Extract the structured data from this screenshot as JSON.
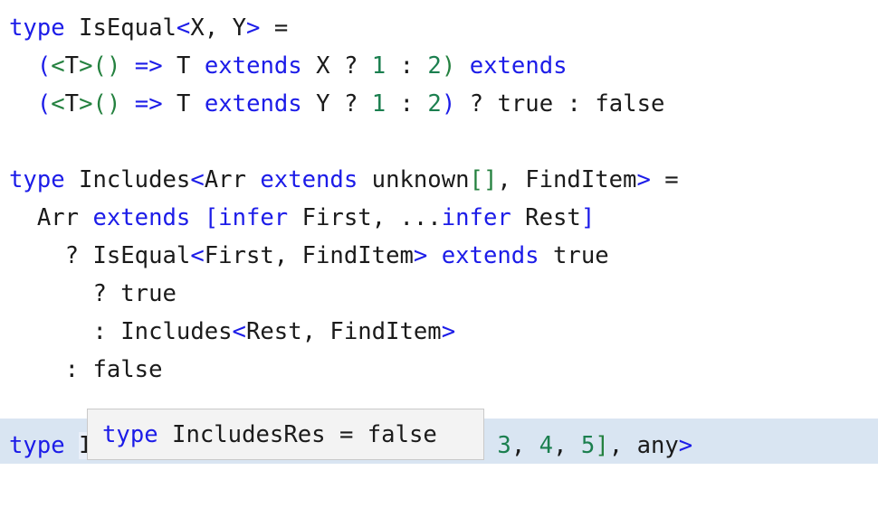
{
  "editor": {
    "language": "TypeScript",
    "background_color": "#ffffff",
    "font_size_px": 25.6,
    "line_height_px": 42,
    "colors": {
      "keyword_blue": "#1c1ce8",
      "literal_green": "#1b7f4f",
      "bracket_green": "#24813f",
      "plain_text": "#1b1b1b",
      "active_line_band": "#d9e5f2",
      "word_occurrence_highlight": "#e9eff9",
      "tooltip_background": "#f3f3f3",
      "tooltip_border": "#c9c9c9"
    }
  },
  "code": {
    "lines": [
      {
        "id": "line-1",
        "plain": "type IsEqual<X, Y> =",
        "tokens": [
          {
            "t": "type",
            "c": "kw"
          },
          {
            "t": " IsEqual",
            "c": "pl"
          },
          {
            "t": "<",
            "c": "brk-b"
          },
          {
            "t": "X, Y",
            "c": "pl"
          },
          {
            "t": ">",
            "c": "brk-b"
          },
          {
            "t": " =",
            "c": "pl"
          }
        ]
      },
      {
        "id": "line-2",
        "plain": "  (<T>() => T extends X ? 1 : 2) extends",
        "tokens": [
          {
            "t": "  ",
            "c": "pl"
          },
          {
            "t": "(",
            "c": "brk-b"
          },
          {
            "t": "<",
            "c": "brk-g"
          },
          {
            "t": "T",
            "c": "pl"
          },
          {
            "t": ">",
            "c": "brk-g"
          },
          {
            "t": "(",
            "c": "brk-g"
          },
          {
            "t": ")",
            "c": "brk-g"
          },
          {
            "t": " ",
            "c": "pl"
          },
          {
            "t": "=>",
            "c": "op"
          },
          {
            "t": " T ",
            "c": "pl"
          },
          {
            "t": "extends",
            "c": "kw"
          },
          {
            "t": " X ? ",
            "c": "pl"
          },
          {
            "t": "1",
            "c": "num"
          },
          {
            "t": " : ",
            "c": "pl"
          },
          {
            "t": "2",
            "c": "num"
          },
          {
            "t": ")",
            "c": "brk-g"
          },
          {
            "t": " ",
            "c": "pl"
          },
          {
            "t": "extends",
            "c": "kw"
          }
        ]
      },
      {
        "id": "line-3",
        "plain": "  (<T>() => T extends Y ? 1 : 2) ? true : false",
        "tokens": [
          {
            "t": "  ",
            "c": "pl"
          },
          {
            "t": "(",
            "c": "brk-b"
          },
          {
            "t": "<",
            "c": "brk-g"
          },
          {
            "t": "T",
            "c": "pl"
          },
          {
            "t": ">",
            "c": "brk-g"
          },
          {
            "t": "(",
            "c": "brk-g"
          },
          {
            "t": ")",
            "c": "brk-g"
          },
          {
            "t": " ",
            "c": "pl"
          },
          {
            "t": "=>",
            "c": "op"
          },
          {
            "t": " T ",
            "c": "pl"
          },
          {
            "t": "extends",
            "c": "kw"
          },
          {
            "t": " Y ? ",
            "c": "pl"
          },
          {
            "t": "1",
            "c": "num"
          },
          {
            "t": " : ",
            "c": "pl"
          },
          {
            "t": "2",
            "c": "num"
          },
          {
            "t": ")",
            "c": "brk-b"
          },
          {
            "t": " ? true : false",
            "c": "pl"
          }
        ]
      },
      {
        "id": "line-4",
        "plain": "",
        "tokens": []
      },
      {
        "id": "line-5",
        "plain": "type Includes<Arr extends unknown[], FindItem> =",
        "tokens": [
          {
            "t": "type",
            "c": "kw"
          },
          {
            "t": " Includes",
            "c": "pl"
          },
          {
            "t": "<",
            "c": "brk-b"
          },
          {
            "t": "Arr ",
            "c": "pl"
          },
          {
            "t": "extends",
            "c": "kw"
          },
          {
            "t": " unknown",
            "c": "pl"
          },
          {
            "t": "[]",
            "c": "brk-g"
          },
          {
            "t": ", FindItem",
            "c": "pl"
          },
          {
            "t": ">",
            "c": "brk-b"
          },
          {
            "t": " =",
            "c": "pl"
          }
        ]
      },
      {
        "id": "line-6",
        "plain": "  Arr extends [infer First, ...infer Rest]",
        "tokens": [
          {
            "t": "  Arr ",
            "c": "pl"
          },
          {
            "t": "extends",
            "c": "kw"
          },
          {
            "t": " ",
            "c": "pl"
          },
          {
            "t": "[",
            "c": "brk-b"
          },
          {
            "t": "infer",
            "c": "kw"
          },
          {
            "t": " First, ...",
            "c": "pl"
          },
          {
            "t": "infer",
            "c": "kw"
          },
          {
            "t": " Rest",
            "c": "pl"
          },
          {
            "t": "]",
            "c": "brk-b"
          }
        ]
      },
      {
        "id": "line-7",
        "plain": "    ? IsEqual<First, FindItem> extends true",
        "tokens": [
          {
            "t": "    ? IsEqual",
            "c": "pl"
          },
          {
            "t": "<",
            "c": "brk-b"
          },
          {
            "t": "First, FindItem",
            "c": "pl"
          },
          {
            "t": ">",
            "c": "brk-b"
          },
          {
            "t": " ",
            "c": "pl"
          },
          {
            "t": "extends",
            "c": "kw"
          },
          {
            "t": " true",
            "c": "pl"
          }
        ]
      },
      {
        "id": "line-8",
        "plain": "      ? true",
        "tokens": [
          {
            "t": "      ? true",
            "c": "pl"
          }
        ]
      },
      {
        "id": "line-9",
        "plain": "      : Includes<Rest, FindItem>",
        "tokens": [
          {
            "t": "      : Includes",
            "c": "pl"
          },
          {
            "t": "<",
            "c": "brk-b"
          },
          {
            "t": "Rest, FindItem",
            "c": "pl"
          },
          {
            "t": ">",
            "c": "brk-b"
          }
        ]
      },
      {
        "id": "line-10",
        "plain": "    : false",
        "tokens": [
          {
            "t": "    : false",
            "c": "pl"
          }
        ]
      },
      {
        "id": "line-11",
        "plain": "",
        "tokens": []
      },
      {
        "id": "line-12",
        "plain": "type IncludesRes = Includes<[1, 2, 3, 4, 5], any>",
        "tokens": [
          {
            "t": "type",
            "c": "kw"
          },
          {
            "t": " ",
            "c": "pl"
          },
          {
            "t": "IncludesRes",
            "c": "pl occ"
          },
          {
            "t": " = Includes",
            "c": "pl"
          },
          {
            "t": "<",
            "c": "brk-b"
          },
          {
            "t": "[",
            "c": "brk-g"
          },
          {
            "t": "1",
            "c": "num"
          },
          {
            "t": ", ",
            "c": "pl"
          },
          {
            "t": "2",
            "c": "num"
          },
          {
            "t": ", ",
            "c": "pl"
          },
          {
            "t": "3",
            "c": "num"
          },
          {
            "t": ", ",
            "c": "pl"
          },
          {
            "t": "4",
            "c": "num"
          },
          {
            "t": ", ",
            "c": "pl"
          },
          {
            "t": "5",
            "c": "num"
          },
          {
            "t": "]",
            "c": "brk-g"
          },
          {
            "t": ", any",
            "c": "pl"
          },
          {
            "t": ">",
            "c": "brk-b"
          }
        ]
      }
    ]
  },
  "hover_tooltip": {
    "visible": true,
    "plain": "type IncludesRes = false",
    "tokens": [
      {
        "t": "type",
        "c": "kw"
      },
      {
        "t": " IncludesRes = false",
        "c": "pl"
      }
    ]
  }
}
